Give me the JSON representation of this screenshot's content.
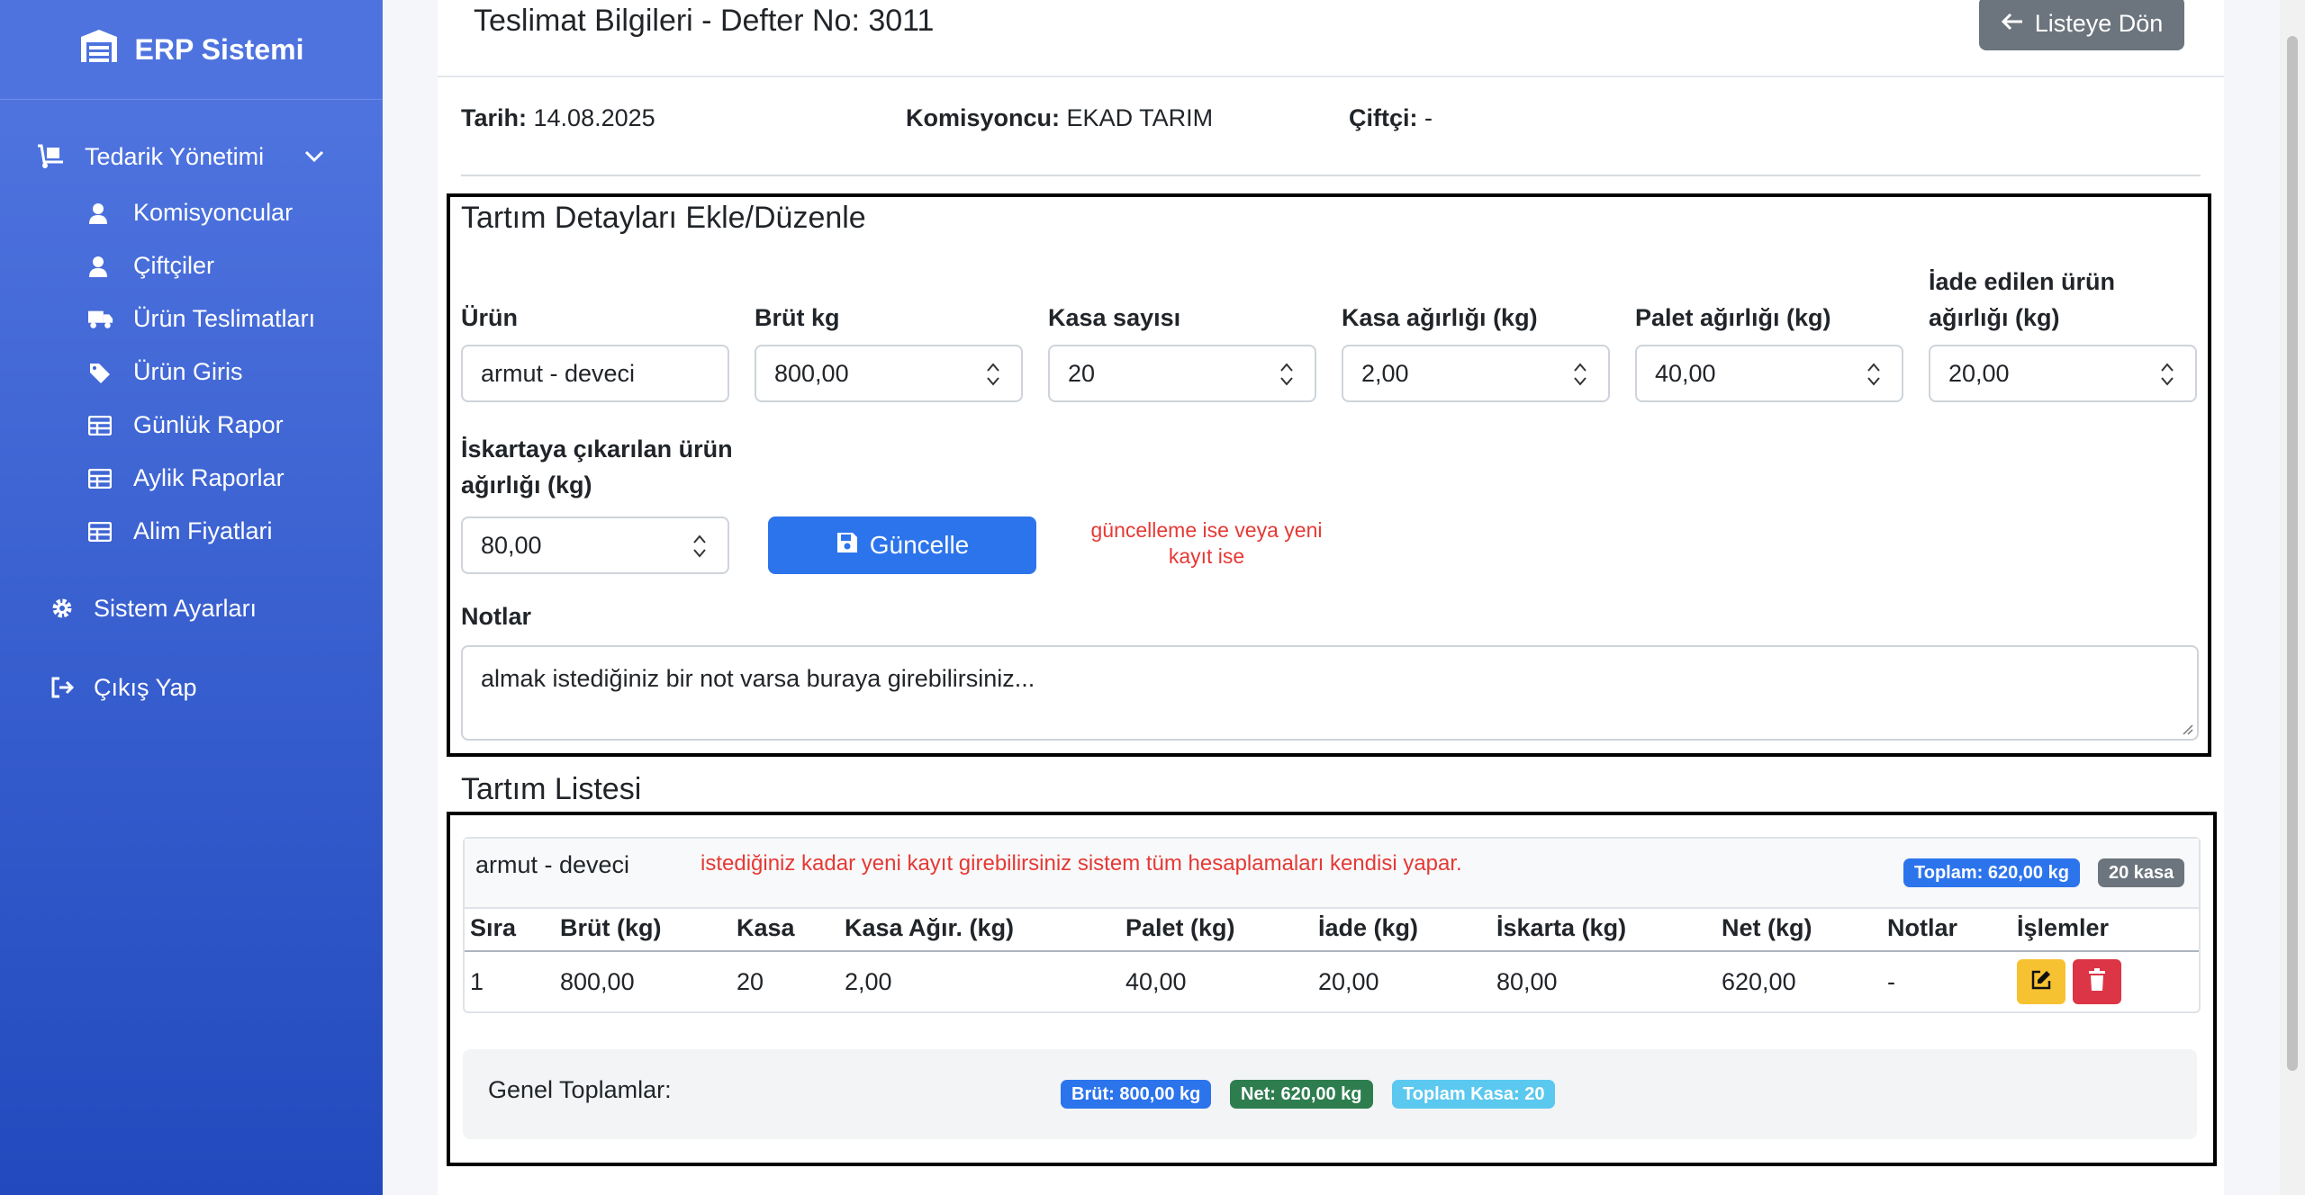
{
  "sidebar": {
    "brand": "ERP Sistemi",
    "group_label": "Tedarik Yönetimi",
    "sub_items": [
      {
        "label": "Komisyoncular",
        "icon": "user-icon"
      },
      {
        "label": "Çiftçiler",
        "icon": "user-icon"
      },
      {
        "label": "Ürün Teslimatları",
        "icon": "truck-icon"
      },
      {
        "label": "Ürün Giris",
        "icon": "tags-icon"
      },
      {
        "label": "Günlük Rapor",
        "icon": "table-icon"
      },
      {
        "label": "Aylik Raporlar",
        "icon": "table-icon"
      },
      {
        "label": "Alim Fiyatlari",
        "icon": "table-icon"
      }
    ],
    "settings_label": "Sistem Ayarları",
    "logout_label": "Çıkış Yap"
  },
  "header": {
    "title": "Teslimat Bilgileri - Defter No: 3011",
    "back_label": "Listeye Dön"
  },
  "meta": {
    "date_label": "Tarih:",
    "date_value": "14.08.2025",
    "broker_label": "Komisyoncu:",
    "broker_value": "EKAD TARIM",
    "farmer_label": "Çiftçi:",
    "farmer_value": "-"
  },
  "form": {
    "title": "Tartım Detayları Ekle/Düzenle",
    "fields": [
      {
        "label": "Ürün",
        "value": "armut - deveci"
      },
      {
        "label": "Brüt kg",
        "value": "800,00"
      },
      {
        "label": "Kasa sayısı",
        "value": "20"
      },
      {
        "label": "Kasa ağırlığı (kg)",
        "value": "2,00"
      },
      {
        "label": "Palet ağırlığı (kg)",
        "value": "40,00"
      },
      {
        "label": "İade edilen ürün ağırlığı (kg)",
        "value": "20,00"
      },
      {
        "label": "İskartaya çıkarılan ürün ağırlığı (kg)",
        "value": "80,00"
      }
    ],
    "update_label": "Güncelle",
    "hint": "güncelleme ise veya yeni kayıt ise",
    "notes_label": "Notlar",
    "notes_value": "almak istediğiniz bir not varsa buraya girebilirsiniz..."
  },
  "list": {
    "title": "Tartım Listesi",
    "product": "armut - deveci",
    "hint": "istediğiniz kadar yeni kayıt girebilirsiniz sistem tüm hesaplamaları kendisi yapar.",
    "total_badge": "Toplam: 620,00 kg",
    "kasa_badge": "20 kasa",
    "columns": [
      "Sıra",
      "Brüt (kg)",
      "Kasa",
      "Kasa Ağır. (kg)",
      "Palet (kg)",
      "İade (kg)",
      "İskarta (kg)",
      "Net (kg)",
      "Notlar",
      "İşlemler"
    ],
    "rows": [
      [
        "1",
        "800,00",
        "20",
        "2,00",
        "40,00",
        "20,00",
        "80,00",
        "620,00",
        "-"
      ]
    ]
  },
  "totals": {
    "label": "Genel Toplamlar:",
    "brut": "Brüt: 800,00 kg",
    "net": "Net: 620,00 kg",
    "kasa": "Toplam Kasa: 20"
  },
  "colors": {
    "primary": "#2c74ec",
    "secondary": "#6c757d",
    "success": "#2e7d4f",
    "info": "#5bc8ef",
    "warning": "#f7c231",
    "danger": "#dc3545",
    "hint_red": "#e53935"
  }
}
